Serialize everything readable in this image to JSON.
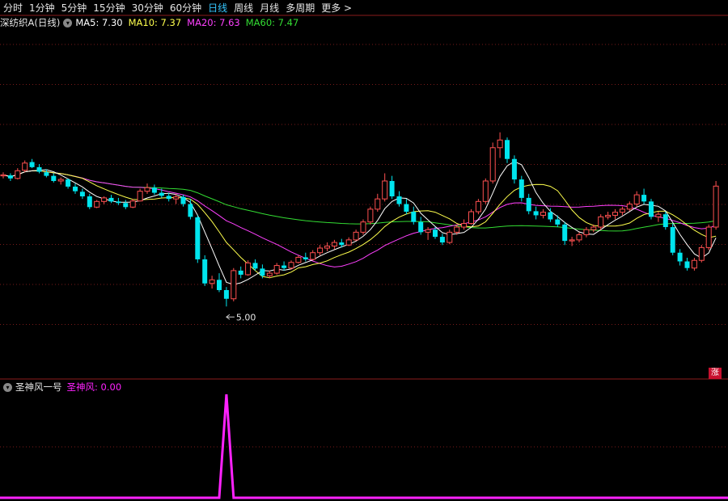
{
  "toolbar": {
    "periods": [
      "分时",
      "1分钟",
      "5分钟",
      "15分钟",
      "30分钟",
      "60分钟",
      "日线",
      "周线",
      "月线",
      "多周期"
    ],
    "active": "日线",
    "more": "更多 >"
  },
  "main": {
    "stock_name": "深纺织A(日线)",
    "ma": [
      {
        "label": "MA5: 7.30",
        "color": "#ffffff"
      },
      {
        "label": "MA10: 7.37",
        "color": "#ffff4d"
      },
      {
        "label": "MA20: 7.63",
        "color": "#ff40ff"
      },
      {
        "label": "MA60: 7.47",
        "color": "#33dd33"
      }
    ],
    "low_marker": "5.00",
    "badge": "涨"
  },
  "indicator": {
    "name": "圣神风一号",
    "value_label": "圣神风: 0.00",
    "color": "#ff22ff"
  },
  "colors": {
    "up": "#ff5050",
    "down": "#00e5ee",
    "grid": "#7a1a1a",
    "axis": "#8c1c1c"
  },
  "chart_data": {
    "type": "candlestick",
    "note_ohlc": "values are prices (yuan), oldest to newest",
    "ohlc": [
      [
        7.55,
        7.62,
        7.5,
        7.57
      ],
      [
        7.56,
        7.6,
        7.45,
        7.5
      ],
      [
        7.5,
        7.7,
        7.48,
        7.65
      ],
      [
        7.66,
        7.85,
        7.62,
        7.8
      ],
      [
        7.82,
        7.88,
        7.7,
        7.72
      ],
      [
        7.72,
        7.78,
        7.6,
        7.63
      ],
      [
        7.62,
        7.68,
        7.52,
        7.55
      ],
      [
        7.55,
        7.6,
        7.42,
        7.45
      ],
      [
        7.45,
        7.52,
        7.38,
        7.48
      ],
      [
        7.48,
        7.5,
        7.3,
        7.34
      ],
      [
        7.34,
        7.4,
        7.2,
        7.25
      ],
      [
        7.24,
        7.3,
        7.1,
        7.15
      ],
      [
        7.15,
        7.2,
        6.9,
        6.94
      ],
      [
        6.94,
        7.08,
        6.92,
        7.05
      ],
      [
        7.05,
        7.15,
        7.0,
        7.12
      ],
      [
        7.12,
        7.18,
        7.02,
        7.05
      ],
      [
        7.05,
        7.12,
        6.98,
        7.02
      ],
      [
        7.02,
        7.08,
        6.9,
        6.94
      ],
      [
        6.94,
        7.1,
        6.92,
        7.06
      ],
      [
        7.06,
        7.3,
        7.05,
        7.25
      ],
      [
        7.25,
        7.4,
        7.2,
        7.32
      ],
      [
        7.32,
        7.38,
        7.18,
        7.22
      ],
      [
        7.22,
        7.3,
        7.12,
        7.16
      ],
      [
        7.16,
        7.22,
        7.05,
        7.1
      ],
      [
        7.1,
        7.2,
        7.0,
        7.14
      ],
      [
        7.14,
        7.18,
        6.95,
        7.0
      ],
      [
        7.0,
        7.1,
        6.7,
        6.75
      ],
      [
        6.74,
        6.78,
        5.85,
        5.92
      ],
      [
        5.92,
        6.0,
        5.4,
        5.45
      ],
      [
        5.45,
        5.6,
        5.35,
        5.52
      ],
      [
        5.52,
        5.65,
        5.28,
        5.32
      ],
      [
        5.32,
        5.38,
        5.0,
        5.15
      ],
      [
        5.15,
        5.75,
        5.1,
        5.7
      ],
      [
        5.7,
        5.78,
        5.55,
        5.62
      ],
      [
        5.62,
        5.9,
        5.6,
        5.85
      ],
      [
        5.85,
        5.92,
        5.7,
        5.74
      ],
      [
        5.74,
        5.82,
        5.55,
        5.6
      ],
      [
        5.6,
        5.7,
        5.55,
        5.65
      ],
      [
        5.65,
        5.85,
        5.62,
        5.8
      ],
      [
        5.8,
        5.88,
        5.7,
        5.75
      ],
      [
        5.75,
        5.9,
        5.72,
        5.86
      ],
      [
        5.86,
        6.0,
        5.84,
        5.96
      ],
      [
        5.96,
        6.05,
        5.88,
        5.92
      ],
      [
        5.92,
        6.1,
        5.9,
        6.05
      ],
      [
        6.05,
        6.2,
        6.0,
        6.14
      ],
      [
        6.14,
        6.25,
        6.08,
        6.18
      ],
      [
        6.18,
        6.3,
        6.12,
        6.25
      ],
      [
        6.25,
        6.32,
        6.15,
        6.2
      ],
      [
        6.2,
        6.35,
        6.18,
        6.3
      ],
      [
        6.3,
        6.5,
        6.28,
        6.45
      ],
      [
        6.45,
        6.7,
        6.4,
        6.65
      ],
      [
        6.65,
        6.95,
        6.6,
        6.9
      ],
      [
        6.9,
        7.2,
        6.85,
        7.1
      ],
      [
        7.1,
        7.6,
        7.05,
        7.45
      ],
      [
        7.45,
        7.55,
        7.1,
        7.15
      ],
      [
        7.15,
        7.25,
        6.95,
        7.0
      ],
      [
        7.0,
        7.1,
        6.8,
        6.85
      ],
      [
        6.85,
        6.95,
        6.6,
        6.65
      ],
      [
        6.65,
        6.75,
        6.4,
        6.45
      ],
      [
        6.45,
        6.55,
        6.3,
        6.5
      ],
      [
        6.5,
        6.55,
        6.32,
        6.36
      ],
      [
        6.36,
        6.42,
        6.2,
        6.25
      ],
      [
        6.25,
        6.5,
        6.22,
        6.45
      ],
      [
        6.45,
        6.6,
        6.4,
        6.55
      ],
      [
        6.55,
        6.7,
        6.5,
        6.62
      ],
      [
        6.62,
        6.9,
        6.6,
        6.85
      ],
      [
        6.85,
        7.1,
        6.8,
        7.05
      ],
      [
        7.05,
        7.5,
        7.0,
        7.45
      ],
      [
        7.45,
        8.2,
        7.4,
        8.1
      ],
      [
        8.1,
        8.4,
        7.9,
        8.25
      ],
      [
        8.25,
        8.3,
        7.8,
        7.88
      ],
      [
        7.88,
        7.95,
        7.4,
        7.48
      ],
      [
        7.48,
        7.55,
        7.05,
        7.12
      ],
      [
        7.12,
        7.2,
        6.8,
        6.86
      ],
      [
        6.86,
        6.95,
        6.7,
        6.78
      ],
      [
        6.78,
        6.9,
        6.72,
        6.84
      ],
      [
        6.84,
        6.92,
        6.65,
        6.7
      ],
      [
        6.7,
        6.78,
        6.55,
        6.6
      ],
      [
        6.6,
        6.65,
        6.2,
        6.28
      ],
      [
        6.28,
        6.36,
        6.18,
        6.3
      ],
      [
        6.3,
        6.45,
        6.25,
        6.4
      ],
      [
        6.4,
        6.55,
        6.35,
        6.5
      ],
      [
        6.5,
        6.6,
        6.45,
        6.55
      ],
      [
        6.55,
        6.8,
        6.5,
        6.75
      ],
      [
        6.75,
        6.85,
        6.7,
        6.78
      ],
      [
        6.78,
        6.9,
        6.7,
        6.84
      ],
      [
        6.84,
        6.95,
        6.78,
        6.9
      ],
      [
        6.9,
        7.05,
        6.86,
        7.0
      ],
      [
        7.0,
        7.25,
        6.95,
        7.18
      ],
      [
        7.18,
        7.3,
        7.0,
        7.05
      ],
      [
        7.05,
        7.1,
        6.7,
        6.75
      ],
      [
        6.75,
        6.85,
        6.65,
        6.8
      ],
      [
        6.8,
        6.85,
        6.5,
        6.55
      ],
      [
        6.55,
        6.62,
        6.0,
        6.05
      ],
      [
        6.05,
        6.12,
        5.8,
        5.88
      ],
      [
        5.88,
        5.95,
        5.7,
        5.75
      ],
      [
        5.75,
        5.95,
        5.7,
        5.9
      ],
      [
        5.9,
        6.2,
        5.86,
        6.15
      ],
      [
        6.15,
        6.6,
        6.1,
        6.55
      ],
      [
        6.55,
        7.45,
        6.5,
        7.35
      ]
    ],
    "indicator_values": [
      0,
      0,
      0,
      0,
      0,
      0,
      0,
      0,
      0,
      0,
      0,
      0,
      0,
      0,
      0,
      0,
      0,
      0,
      0,
      0,
      0,
      0,
      0,
      0,
      0,
      0,
      0,
      0,
      0,
      0,
      0,
      1,
      0,
      0,
      0,
      0,
      0,
      0,
      0,
      0,
      0,
      0,
      0,
      0,
      0,
      0,
      0,
      0,
      0,
      0,
      0,
      0,
      0,
      0,
      0,
      0,
      0,
      0,
      0,
      0,
      0,
      0,
      0,
      0,
      0,
      0,
      0,
      0,
      0,
      0,
      0,
      0,
      0,
      0,
      0,
      0,
      0,
      0,
      0,
      0,
      0,
      0,
      0,
      0,
      0,
      0,
      0,
      0,
      0,
      0,
      0,
      0,
      0,
      0,
      0,
      0,
      0,
      0,
      0,
      0
    ]
  }
}
